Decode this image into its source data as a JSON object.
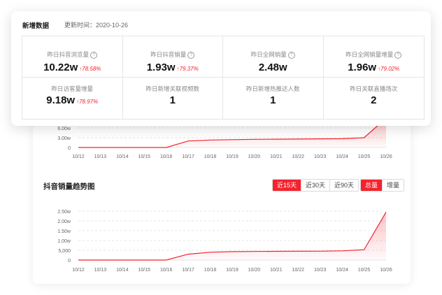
{
  "stats_card": {
    "title": "新增数据",
    "update_time": "更新时间：2020-10-26",
    "metrics": [
      {
        "label": "昨日抖音浏览量",
        "value": "10.22w",
        "change": "↑78.58%",
        "help": "?"
      },
      {
        "label": "昨日抖音销量",
        "value": "1.93w",
        "change": "↑79.37%",
        "help": "?"
      },
      {
        "label": "昨日全网销量",
        "value": "2.48w",
        "help": "?"
      },
      {
        "label": "昨日全网销量增量",
        "value": "1.96w",
        "change": "↑79.02%",
        "help": "?"
      },
      {
        "label": "昨日访客量增量",
        "value": "9.18w",
        "change": "↑78.97%"
      },
      {
        "label": "昨日新增关联视频数",
        "value": "1"
      },
      {
        "label": "昨日新增热推达人数",
        "value": "1"
      },
      {
        "label": "昨日关联直播场次",
        "value": "2"
      }
    ]
  },
  "trend_controls": {
    "title": "抖音销量趋势图",
    "ranges": [
      "近15天",
      "近30天",
      "近90天"
    ],
    "active_range": "近15天",
    "types": [
      "总量",
      "增量"
    ],
    "active_type": "总量"
  },
  "colors": {
    "accent": "#f5222d",
    "grid": "#e6e6e6",
    "axis_text": "#666666"
  },
  "chart_data": [
    {
      "type": "area",
      "partially_hidden": true,
      "x": [
        "10/12",
        "10/13",
        "10/14",
        "10/15",
        "10/16",
        "10/17",
        "10/18",
        "10/19",
        "10/20",
        "10/21",
        "10/22",
        "10/23",
        "10/24",
        "10/25",
        "10/26"
      ],
      "ytick_labels": [
        "0",
        "3.00w",
        "6.00w"
      ],
      "ytick_values": [
        0,
        30000,
        60000
      ],
      "series": [
        {
          "values": [
            0,
            0,
            0,
            0,
            0,
            20000,
            23000,
            24000,
            25000,
            25500,
            26000,
            26500,
            27000,
            30000,
            90000
          ]
        }
      ],
      "ylim": [
        0,
        60000
      ]
    },
    {
      "type": "area",
      "title": "抖音销量趋势图",
      "x": [
        "10/12",
        "10/13",
        "10/14",
        "10/15",
        "10/16",
        "10/17",
        "10/18",
        "10/19",
        "10/20",
        "10/21",
        "10/22",
        "10/23",
        "10/24",
        "10/25",
        "10/26"
      ],
      "ytick_labels": [
        "0",
        "5,000",
        "1.00w",
        "1.50w",
        "2.00w",
        "2.50w"
      ],
      "ytick_values": [
        0,
        5000,
        10000,
        15000,
        20000,
        25000
      ],
      "series": [
        {
          "values": [
            0,
            0,
            0,
            0,
            0,
            3000,
            4000,
            4300,
            4400,
            4450,
            4500,
            4550,
            4700,
            5300,
            24500
          ]
        }
      ],
      "ylim": [
        0,
        25000
      ]
    }
  ]
}
